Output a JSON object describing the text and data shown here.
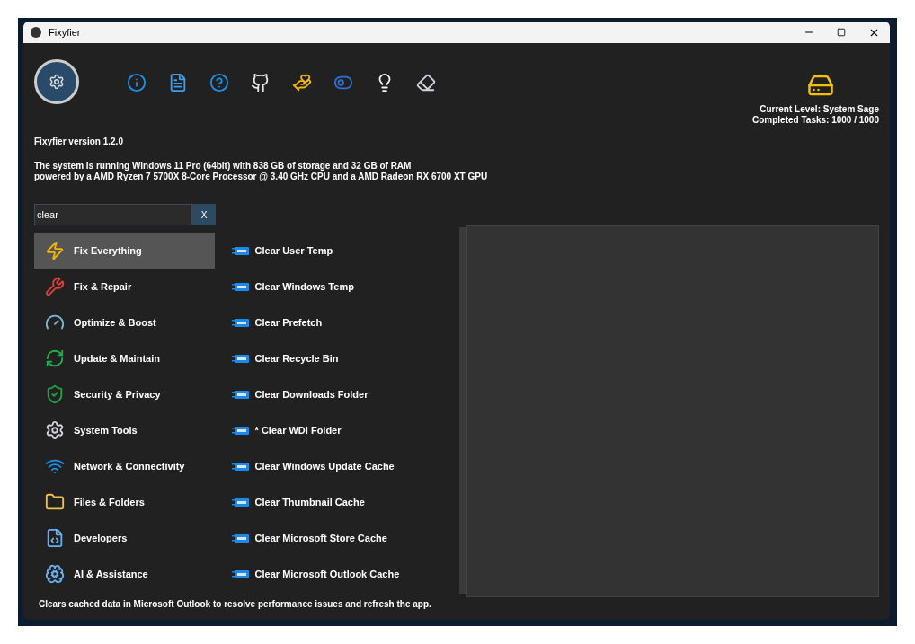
{
  "window": {
    "title": "Fixyfier"
  },
  "level": {
    "current": "Current Level: System Sage",
    "tasks": "Completed Tasks: 1000 / 1000"
  },
  "version": "Fixyfier version 1.2.0",
  "system_info": [
    "The system is running Windows 11 Pro (64bit) with 838 GB of storage and 32 GB of RAM",
    "powered by a AMD Ryzen 7 5700X 8-Core Processor @ 3.40 GHz CPU and a AMD Radeon RX 6700 XT GPU"
  ],
  "search": {
    "value": "clear",
    "clear_button": "X"
  },
  "categories": [
    {
      "label": "Fix Everything",
      "selected": true
    },
    {
      "label": "Fix & Repair",
      "selected": false
    },
    {
      "label": "Optimize & Boost",
      "selected": false
    },
    {
      "label": "Update & Maintain",
      "selected": false
    },
    {
      "label": "Security & Privacy",
      "selected": false
    },
    {
      "label": "System Tools",
      "selected": false
    },
    {
      "label": "Network & Connectivity",
      "selected": false
    },
    {
      "label": "Files & Folders",
      "selected": false
    },
    {
      "label": "Developers",
      "selected": false
    },
    {
      "label": "AI & Assistance",
      "selected": false
    }
  ],
  "tasks": [
    "Clear User Temp",
    "Clear Windows Temp",
    "Clear Prefetch",
    "Clear Recycle Bin",
    "Clear Downloads Folder",
    "* Clear WDI Folder",
    "Clear Windows Update Cache",
    "Clear Thumbnail Cache",
    "Clear Microsoft Store Cache",
    "Clear Microsoft Outlook Cache"
  ],
  "status_bar": "Clears cached data in Microsoft Outlook to resolve performance issues and refresh the app."
}
